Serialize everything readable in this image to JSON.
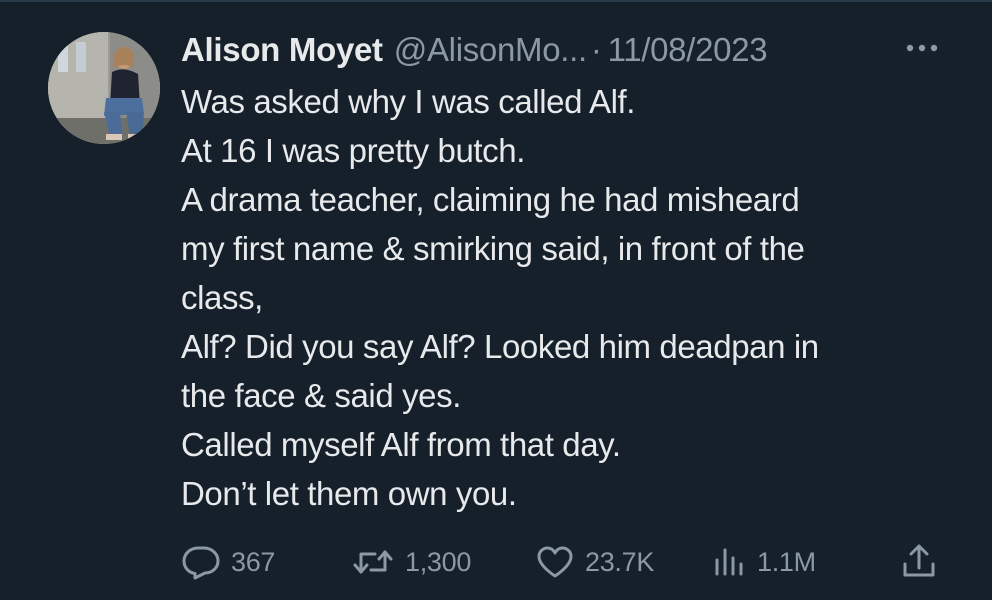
{
  "tweet": {
    "author": {
      "name": "Alison Moyet",
      "handle": "@AlisonMo...",
      "separator": "·",
      "date": "11/08/2023"
    },
    "lines": [
      "Was asked why I was called Alf.",
      "At 16 I was pretty butch.",
      "A drama teacher, claiming he had misheard",
      "my first name & smirking said, in front of the",
      "class,",
      "Alf? Did you say Alf? Looked him deadpan in",
      "the face & said yes.",
      "Called myself Alf from that day.",
      "Don’t let them own you."
    ],
    "actions": {
      "replies": "367",
      "retweets": "1,300",
      "likes": "23.7K",
      "views": "1.1M"
    },
    "icons": {
      "more": "more-horizontal-icon",
      "reply": "reply-bubble-icon",
      "retweet": "retweet-icon",
      "like": "heart-icon",
      "views": "bar-chart-icon",
      "share": "share-upload-icon"
    },
    "colors": {
      "background": "#15202b",
      "text_primary": "#e7e9ea",
      "text_secondary": "#8b98a5"
    }
  }
}
